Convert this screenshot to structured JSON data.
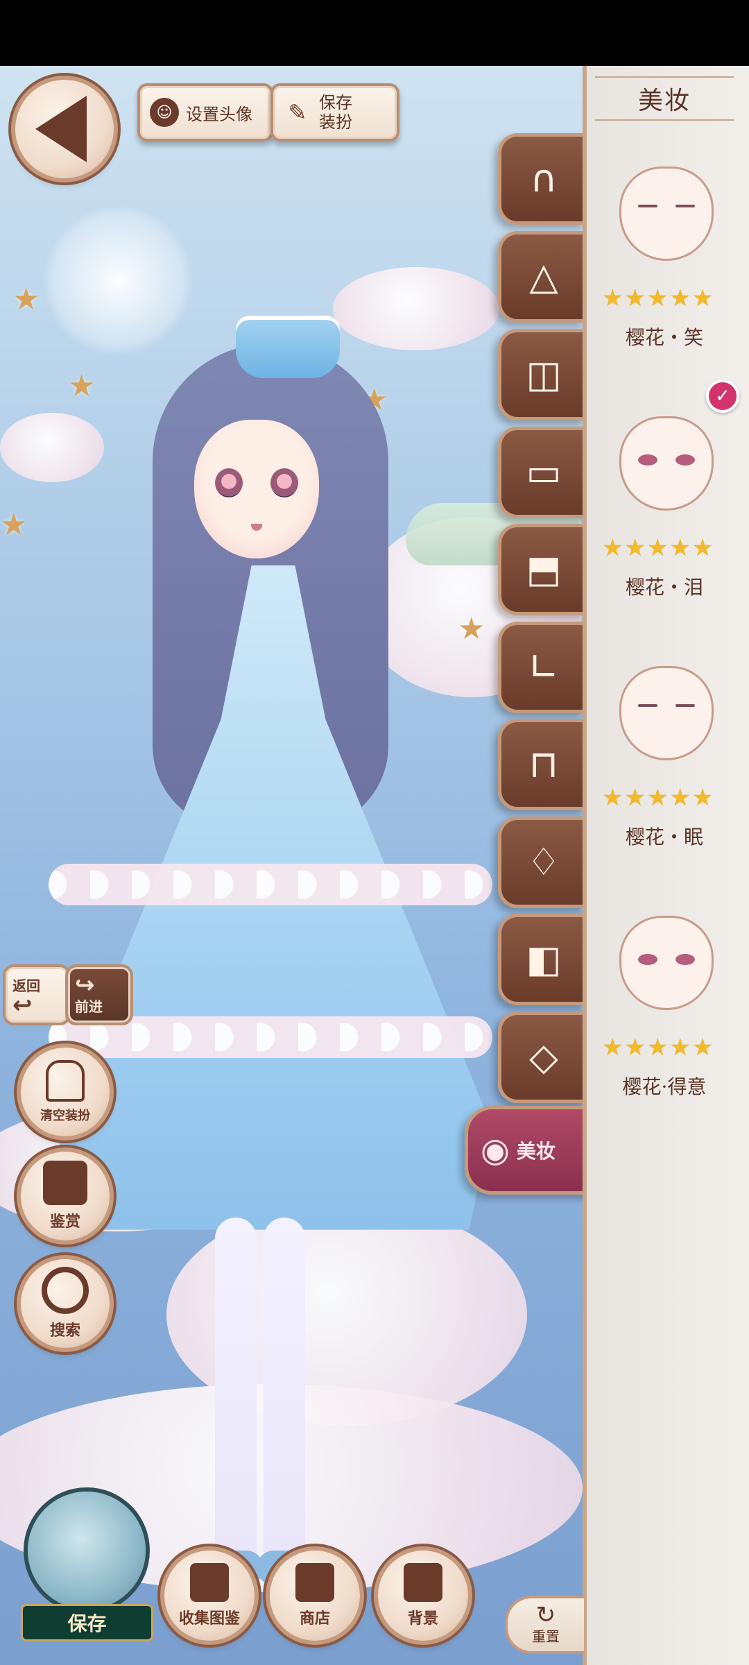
{
  "top": {
    "back_icon": "back-arrow-icon",
    "set_avatar_label": "设置头像",
    "save_outfit_label": "保存\n装扮"
  },
  "history": {
    "undo_label": "返回",
    "redo_label": "前进"
  },
  "left_buttons": {
    "clear_label": "清空装扮",
    "appreciate_label": "鉴赏",
    "search_label": "搜索"
  },
  "bottom": {
    "save_label": "保存",
    "collect_label": "收集图鉴",
    "shop_label": "商店",
    "background_label": "背景"
  },
  "categories": [
    {
      "icon": "hair-icon"
    },
    {
      "icon": "dress-icon"
    },
    {
      "icon": "coat-icon"
    },
    {
      "icon": "top-icon"
    },
    {
      "icon": "bottom-icon"
    },
    {
      "icon": "socks-icon"
    },
    {
      "icon": "shoes-icon"
    },
    {
      "icon": "accessory-icon"
    },
    {
      "icon": "bag-icon"
    },
    {
      "icon": "stand-icon"
    },
    {
      "icon": "makeup-icon",
      "label": "美妆",
      "active": true
    }
  ],
  "panel": {
    "title": "美妆",
    "items": [
      {
        "name": "樱花・笑",
        "stars": "★★★★★",
        "eyes": "closed",
        "selected": false
      },
      {
        "name": "樱花・泪",
        "stars": "★★★★★",
        "eyes": "open",
        "selected": true
      },
      {
        "name": "樱花・眠",
        "stars": "★★★★★",
        "eyes": "closed",
        "selected": false
      },
      {
        "name": "樱花·得意",
        "stars": "★★★★★",
        "eyes": "open",
        "selected": false
      }
    ]
  },
  "reset_label": "重置",
  "colors": {
    "brown": "#6a3b2a",
    "accent_pink": "#b04a67",
    "panel_bg": "#f2efeb",
    "star_gold": "#f2b928"
  }
}
